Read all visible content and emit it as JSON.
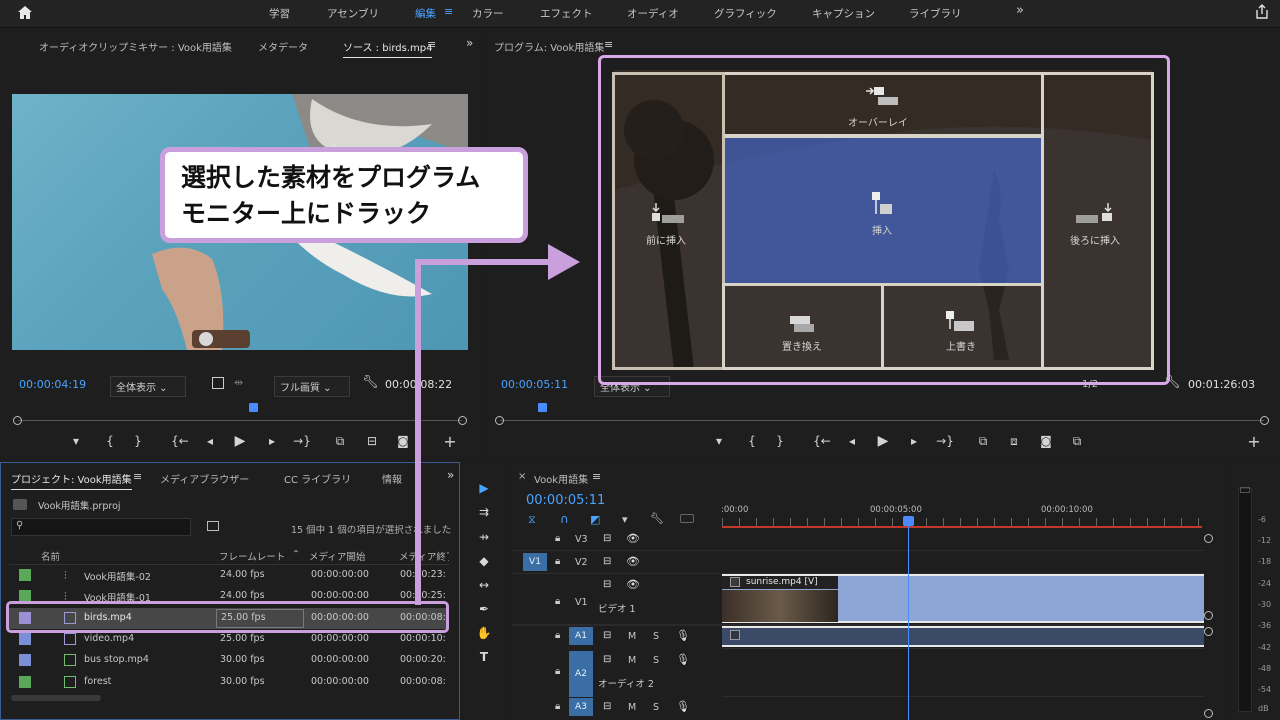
{
  "topbar": {
    "tabs": [
      "学習",
      "アセンブリ",
      "編集",
      "カラー",
      "エフェクト",
      "オーディオ",
      "グラフィック",
      "キャプション",
      "ライブラリ"
    ],
    "active_tab": "編集",
    "more": "»"
  },
  "source_panel": {
    "tabs": [
      "オーディオクリップミキサー : Vook用語集",
      "メタデータ",
      "ソース : birds.mp4"
    ],
    "timecode_current": "00:00:04:19",
    "timecode_duration": "00:00:08:22",
    "zoom_select": "全体表示",
    "quality_select": "フル画質"
  },
  "program_panel": {
    "title": "プログラム: Vook用語集",
    "timecode_current": "00:00:05:11",
    "timecode_duration": "00:01:26:03",
    "zoom_select": "全体表示",
    "fraction": "1/2",
    "drop_zones": {
      "overlay": "オーバーレイ",
      "insert": "挿入",
      "insert_before": "前に挿入",
      "insert_after": "後ろに挿入",
      "replace": "置き換え",
      "overwrite": "上書き"
    }
  },
  "callout": {
    "line1": "選択した素材をプログラム",
    "line2": "モニター上にドラック",
    "accent_color": "#c9a0dc"
  },
  "project_panel": {
    "tabs": [
      "プロジェクト: Vook用語集",
      "メディアブラウザー",
      "CC ライブラリ",
      "情報"
    ],
    "project_file": "Vook用語集.prproj",
    "status": "15 個中 1 個の項目が選択されました",
    "columns": [
      "名前",
      "フレームレート",
      "メディア開始",
      "メディア終了"
    ],
    "rows": [
      {
        "name": "Vook用語集-02",
        "fps": "24.00 fps",
        "start": "00:00:00:00",
        "end": "00:00:23:",
        "color": "#5aa95a"
      },
      {
        "name": "Vook用語集-01",
        "fps": "24.00 fps",
        "start": "00:00:00:00",
        "end": "00:00:25:",
        "color": "#5aa95a"
      },
      {
        "name": "birds.mp4",
        "fps": "25.00 fps",
        "start": "00:00:00:00",
        "end": "00:00:08:",
        "color": "#9b8fd6"
      },
      {
        "name": "video.mp4",
        "fps": "25.00 fps",
        "start": "00:00:00:00",
        "end": "00:00:10:",
        "color": "#7b8fd6"
      },
      {
        "name": "bus stop.mp4",
        "fps": "30.00 fps",
        "start": "00:00:00:00",
        "end": "00:00:20:",
        "color": "#7b8fd6"
      },
      {
        "name": "forest",
        "fps": "30.00 fps",
        "start": "00:00:00:00",
        "end": "00:00:08:",
        "color": "#5aa95a"
      }
    ]
  },
  "timeline": {
    "sequence_tab": "Vook用語集",
    "timecode": "00:00:05:11",
    "ruler": [
      ":00:00",
      "00:00:05:00",
      "00:00:10:00"
    ],
    "video_tracks": [
      "V3",
      "V2",
      "V1"
    ],
    "audio_tracks": [
      "A1",
      "A2",
      "A3"
    ],
    "v1_name": "ビデオ 1",
    "a2_name": "オーディオ 2",
    "clip_name": "sunrise.mp4 [V]",
    "mute": "M",
    "solo": "S",
    "source_patch": "V1"
  },
  "meter": {
    "labels": [
      "-6",
      "-12",
      "-18",
      "-24",
      "-30",
      "-36",
      "-42",
      "-48",
      "-54",
      "dB"
    ]
  }
}
